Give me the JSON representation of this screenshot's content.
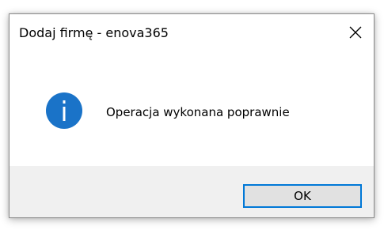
{
  "window": {
    "title": "Dodaj firmę - enova365",
    "close_icon": "close-icon"
  },
  "message": {
    "icon": "info-icon",
    "text": "Operacja wykonana poprawnie"
  },
  "buttons": {
    "ok_label": "OK"
  },
  "colors": {
    "info_icon_fill": "#1a73c8",
    "button_focus_border": "#0078d7",
    "footer_background": "#f0f0f0"
  }
}
